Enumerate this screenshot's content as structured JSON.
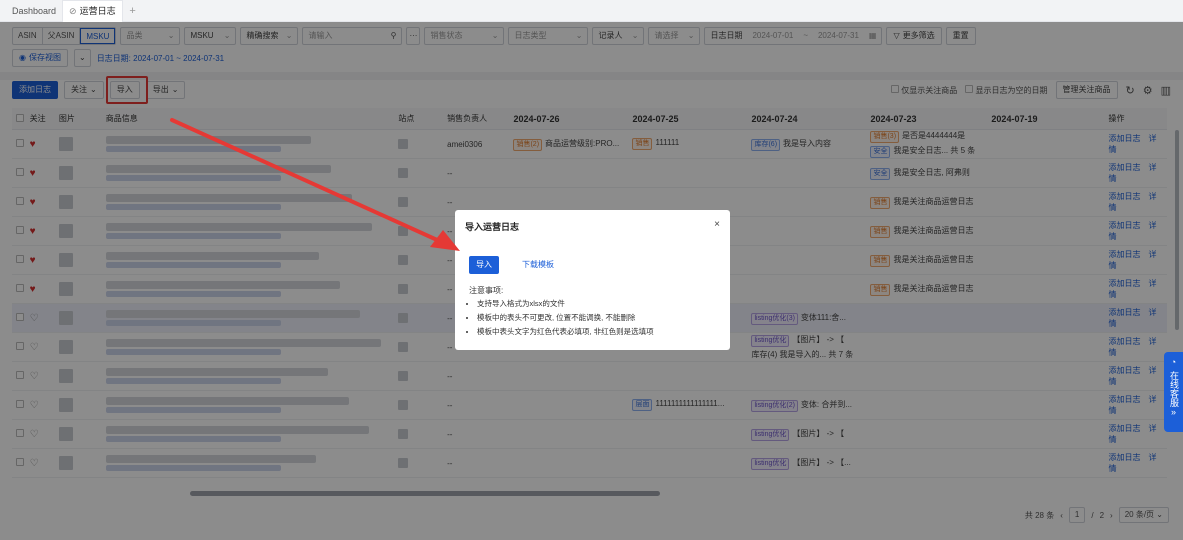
{
  "tabs": [
    {
      "label": "Dashboard",
      "active": false
    },
    {
      "label": "运营日志",
      "active": true
    }
  ],
  "filters": {
    "search_type_segments": [
      "ASIN",
      "父ASIN",
      "MSKU"
    ],
    "active_segment": "MSKU",
    "category_placeholder": "品类",
    "msku_select": "MSKU",
    "match_select": "精确搜索",
    "search_placeholder": "请输入",
    "more_dots": "···",
    "sales_status_placeholder": "销售状态",
    "log_type_placeholder": "日志类型",
    "recorder_placeholder": "记录人",
    "selection_placeholder": "请选择",
    "date_label": "日志日期",
    "date_start": "2024-07-01",
    "date_sep": "~",
    "date_end": "2024-07-31",
    "more_filter_label": "更多筛选",
    "reset_label": "重置",
    "save_view_label": "保存视图",
    "active_chip": "日志日期: 2024-07-01 ~ 2024-07-31"
  },
  "toolbar": {
    "add_log_label": "添加日志",
    "follow_label": "关注",
    "import_label": "导入",
    "export_label": "导出",
    "only_followed_label": "仅显示关注商品",
    "show_empty_dates_label": "显示日志为空的日期",
    "manage_followed_label": "管理关注商品"
  },
  "table": {
    "headers": {
      "follow": "关注",
      "image": "图片",
      "product": "商品信息",
      "site": "站点",
      "sales_owner": "销售负责人",
      "d1": "2024-07-26",
      "d2": "2024-07-25",
      "d3": "2024-07-24",
      "d4": "2024-07-23",
      "d5": "2024-07-19",
      "ops": "操作"
    },
    "rows": [
      {
        "followed": true,
        "owner": "amei0306",
        "d1_tag": "销售(2)",
        "d1_text": "商品运营级别:PRO...",
        "d2_tag": "销售",
        "d2_text": "111111",
        "d3_tag": "库存(6)",
        "d3_text": "我是导入内容",
        "d4_tag": "销售(3)",
        "d4_text": "是否是4444444是",
        "d4_tag2": "安全",
        "d4_text2": "我是安全日志... 共 5 条",
        "selected": false
      },
      {
        "followed": true,
        "owner": "--",
        "d4_tag": "安全",
        "d4_text": "我是安全日志, 阿弗则",
        "selected": false
      },
      {
        "followed": true,
        "owner": "--",
        "d4_tag": "销售",
        "d4_text": "我是关注商品运营日志",
        "selected": false
      },
      {
        "followed": true,
        "owner": "--",
        "d4_tag": "销售",
        "d4_text": "我是关注商品运营日志",
        "selected": false
      },
      {
        "followed": true,
        "owner": "--",
        "d4_tag": "销售",
        "d4_text": "我是关注商品运营日志",
        "selected": false
      },
      {
        "followed": true,
        "owner": "--",
        "d4_tag": "销售",
        "d4_text": "我是关注商品运营日志",
        "selected": false
      },
      {
        "followed": false,
        "owner": "--",
        "d3_tag": "listing优化(3)",
        "d3_text": "变体111:舍...",
        "selected": true
      },
      {
        "followed": false,
        "owner": "--",
        "d3_tag": "listing优化",
        "d3_text": "【图片】 -> 【",
        "d3_text2": "库存(4) 我是导入的... 共 7 条",
        "selected": false
      },
      {
        "followed": false,
        "owner": "--",
        "selected": false
      },
      {
        "followed": false,
        "owner": "--",
        "d2_tag": "层面",
        "d2_text": "1111111111111111...",
        "d3_tag": "listing优化(2)",
        "d3_text": "变体: 合并到...",
        "selected": false
      },
      {
        "followed": false,
        "owner": "--",
        "d3_tag": "listing优化",
        "d3_text": "【图片】 -> 【",
        "selected": false
      },
      {
        "followed": false,
        "owner": "--",
        "d3_tag": "listing优化",
        "d3_text": "【图片】 -> 【...",
        "selected": false
      }
    ],
    "op_add": "添加日志",
    "op_detail": "详情"
  },
  "pagination": {
    "total": "共 28 条",
    "current": "1",
    "sep": "/",
    "pages": "2",
    "page_size": "20 条/页"
  },
  "dialog": {
    "title": "导入运营日志",
    "close": "×",
    "import_button": "导入",
    "template_link": "下载模板",
    "notes_title": "注意事项:",
    "notes": [
      "支持导入格式为xlsx的文件",
      "模板中的表头不可更改, 位置不能调换, 不能删除",
      "模板中表头文字为红色代表必填项, 非红色则是选填项"
    ]
  },
  "service_widget": {
    "label": "在线客服",
    "arrow": "»"
  },
  "colors": {
    "primary": "#1c5fd8",
    "annotation_red": "#e53935"
  }
}
